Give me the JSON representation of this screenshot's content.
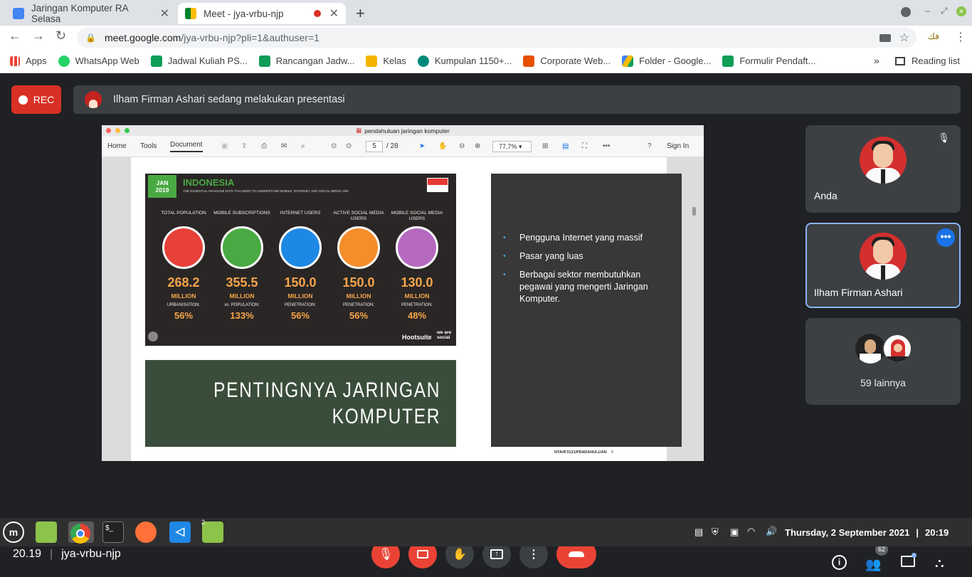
{
  "browser": {
    "tabs": [
      {
        "title": "Jaringan Komputer RA Selasa",
        "active": false
      },
      {
        "title": "Meet - jya-vrbu-njp",
        "active": true
      }
    ],
    "new_tab": "+",
    "url_host": "meet.google.com",
    "url_path": "/jya-vrbu-njp?pli=1&authuser=1",
    "bookmarks": [
      "Apps",
      "WhatsApp Web",
      "Jadwal Kuliah PS...",
      "Rancangan Jadw...",
      "Kelas",
      "Kumpulan 1150+...",
      "Corporate Web...",
      "Folder - Google...",
      "Formulir Pendaft..."
    ],
    "bookmarks_more": "»",
    "reading_list": "Reading list",
    "ext_label": "فك"
  },
  "meet": {
    "rec_label": "REC",
    "presenter_banner": "Ilham Firman Ashari sedang melakukan presentasi",
    "time": "20.19",
    "meeting_code": "jya-vrbu-njp",
    "participant_count": "62",
    "tiles": [
      {
        "name": "Anda"
      },
      {
        "name": "Ilham Firman Ashari"
      },
      {
        "name": "59 lainnya"
      }
    ]
  },
  "pdf": {
    "title": "pendahuluan jaringan komputer",
    "menu": [
      "Home",
      "Tools",
      "Document"
    ],
    "page_current": "5",
    "page_total": "/ 28",
    "zoom": "77,7%",
    "sign_in": "Sign In",
    "footer": "NTA/IF3131/PENDAHULUAN",
    "footer_page": "5"
  },
  "slide_stats": {
    "badge_month": "JAN",
    "badge_year": "2019",
    "country": "INDONESIA",
    "subtitle": "THE ESSENTIAL HEADLINE DATA YOU NEED TO UNDERSTAND MOBILE, INTERNET, AND SOCIAL MEDIA USE",
    "stats": [
      {
        "label": "TOTAL POPULATION",
        "value": "268.2",
        "unit": "MILLION",
        "sub": "URBANISATION:",
        "pct": "56%",
        "color": "#e8413a"
      },
      {
        "label": "MOBILE SUBSCRIPTIONS",
        "value": "355.5",
        "unit": "MILLION",
        "sub": "vs. POPULATION:",
        "pct": "133%",
        "color": "#49a942"
      },
      {
        "label": "INTERNET USERS",
        "value": "150.0",
        "unit": "MILLION",
        "sub": "PENETRATION:",
        "pct": "56%",
        "color": "#1e88e5"
      },
      {
        "label": "ACTIVE SOCIAL MEDIA USERS",
        "value": "150.0",
        "unit": "MILLION",
        "sub": "PENETRATION:",
        "pct": "56%",
        "color": "#f58d2a"
      },
      {
        "label": "MOBILE SOCIAL MEDIA USERS",
        "value": "130.0",
        "unit": "MILLION",
        "sub": "PENETRATION:",
        "pct": "48%",
        "color": "#b56ac0"
      }
    ],
    "brand1": "Hootsuite",
    "brand2": "we are social"
  },
  "slide_bullets": [
    "Pengguna Internet yang massif",
    "Pasar yang luas",
    "Berbagai sektor membutuhkan pegawai yang mengerti Jaringan Komputer."
  ],
  "slide_title": {
    "line1": "PENTINGNYA JARINGAN",
    "line2": "KOMPUTER"
  },
  "taskbar": {
    "clock": "Thursday, 2 September 2021",
    "time": "20:19",
    "badge": "2"
  }
}
